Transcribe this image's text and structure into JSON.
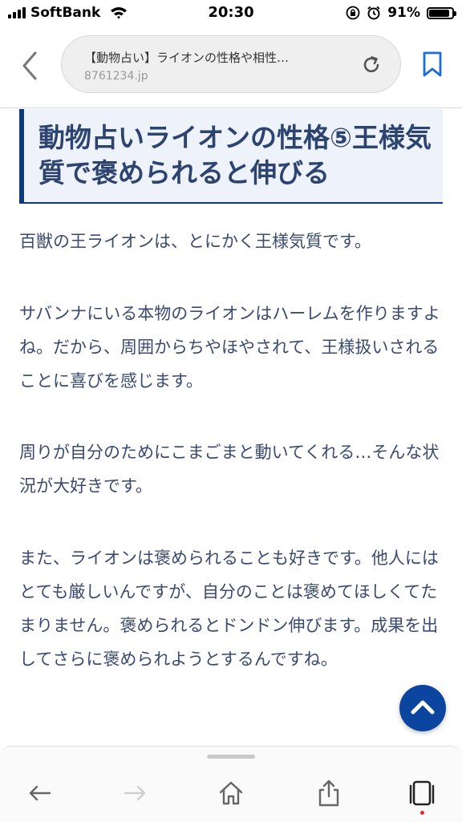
{
  "status_bar": {
    "carrier": "SoftBank",
    "time": "20:30",
    "battery": "91%",
    "battery_level": 0.91
  },
  "browser": {
    "page_title": "【動物占い】ライオンの性格や相性…",
    "domain": "8761234.jp"
  },
  "article": {
    "heading": "動物占いライオンの性格⑤王様気質で褒められると伸びる",
    "paragraphs": [
      "百獣の王ライオンは、とにかく王様気質です。",
      "サバンナにいる本物のライオンはハーレムを作りますよね。だから、周囲からちやほやされて、王様扱いされることに喜びを感じます。",
      "周りが自分のためにこまごまと動いてくれる…そんな状況が大好きです。",
      "また、ライオンは褒められることも好きです。他人にはとても厳しいんですが、自分のことは褒めてほしくてたまりません。褒められるとドンドン伸びます。成果を出してさらに褒められようとするんですね。"
    ]
  },
  "icons": {
    "back": "chevron-left-icon",
    "reload": "reload-icon",
    "bookmark": "bookmark-icon",
    "scroll_top": "chevron-up-icon",
    "nav_back": "arrow-left-icon",
    "nav_forward": "arrow-right-icon",
    "home": "home-icon",
    "share": "share-icon",
    "tabs": "tabs-icon"
  },
  "colors": {
    "accent": "#0b45a0",
    "heading_text": "#2e4470",
    "body_text": "#3b4a72",
    "heading_bg": "#eef3fb",
    "heading_border": "#0d3b78"
  }
}
